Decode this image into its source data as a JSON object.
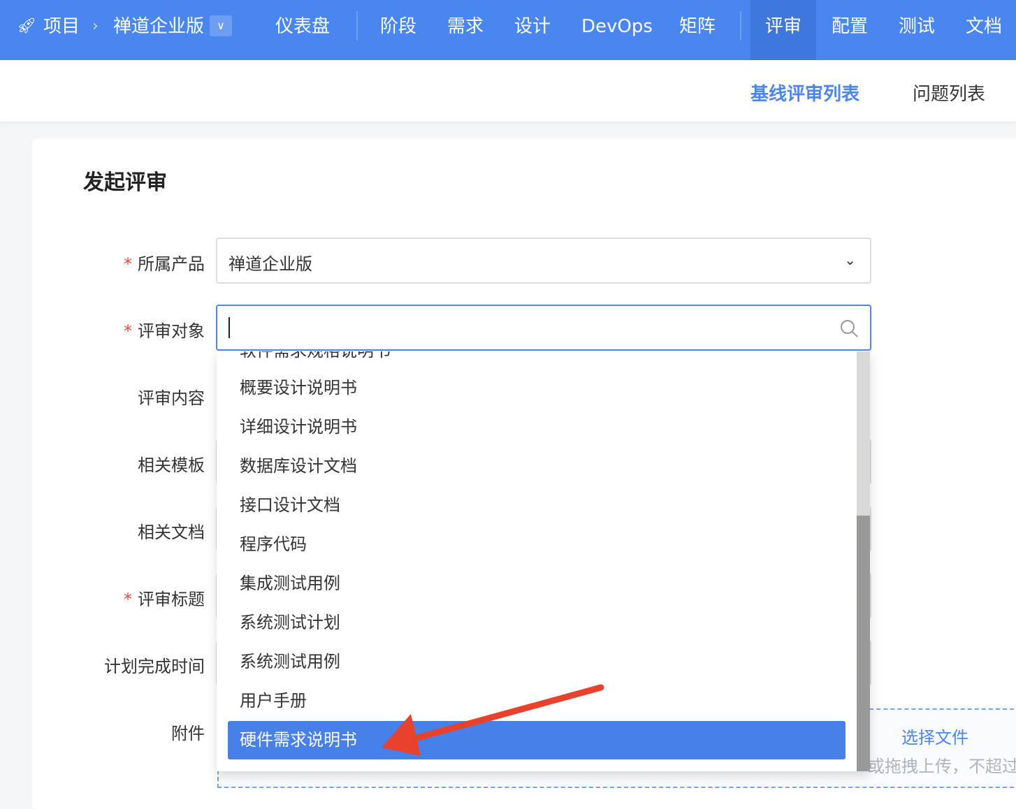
{
  "nav": {
    "project": "项目",
    "product": "禅道企业版",
    "items": [
      "仪表盘",
      "阶段",
      "需求",
      "设计",
      "DevOps",
      "矩阵",
      "评审",
      "配置",
      "测试",
      "文档"
    ],
    "active": "评审"
  },
  "subnav": {
    "items": [
      "基线评审列表",
      "问题列表"
    ],
    "active": "基线评审列表"
  },
  "form": {
    "title": "发起评审",
    "labels": {
      "product": "所属产品",
      "object": "评审对象",
      "content": "评审内容",
      "template": "相关模板",
      "doc": "相关文档",
      "title": "评审标题",
      "deadline": "计划完成时间",
      "attachment": "附件"
    },
    "required_mark": "*",
    "product_value": "禅道企业版",
    "object_value": ""
  },
  "dropdown": {
    "options": [
      "软件需求规格说明书",
      "概要设计说明书",
      "详细设计说明书",
      "数据库设计文档",
      "接口设计文档",
      "程序代码",
      "集成测试用例",
      "系统测试计划",
      "系统测试用例",
      "用户手册",
      "硬件需求说明书"
    ],
    "selected": "硬件需求说明书"
  },
  "upload": {
    "button": "选择文件",
    "hint": "或拖拽上传，不超过"
  },
  "colors": {
    "brand": "#4a86f0",
    "selected": "#4680e8",
    "required": "#e84a3e",
    "annotation_arrow": "#e8412c"
  }
}
